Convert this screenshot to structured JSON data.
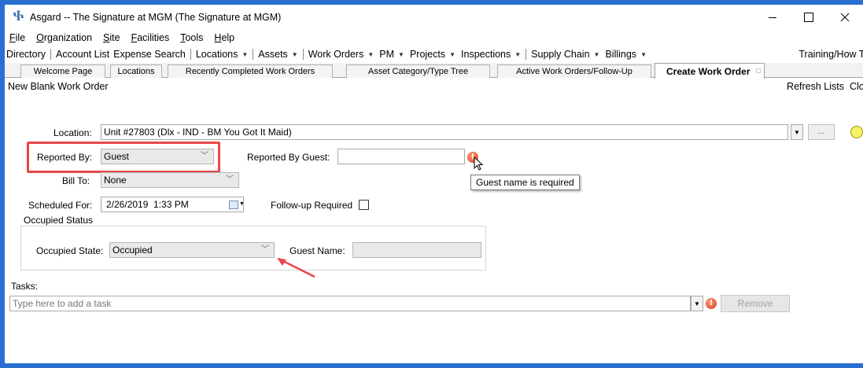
{
  "window": {
    "title": "Asgard -- The Signature at MGM (The Signature at MGM)",
    "app_icon": "asgard-logo-icon",
    "controls": [
      "minimize",
      "maximize",
      "close"
    ]
  },
  "menu": [
    {
      "label": "File",
      "accel": "F",
      "rest": "ile"
    },
    {
      "label": "Organization",
      "accel": "O",
      "rest": "rganization"
    },
    {
      "label": "Site",
      "accel": "S",
      "rest": "ite"
    },
    {
      "label": "Facilities",
      "accel": "F",
      "rest": "acilities"
    },
    {
      "label": "Tools",
      "accel": "T",
      "rest": "ools"
    },
    {
      "label": "Help",
      "accel": "H",
      "rest": "elp"
    }
  ],
  "toolbar": {
    "directory": "Directory",
    "account_list": "Account List",
    "expense_search": "Expense Search",
    "locations": "Locations",
    "assets": "Assets",
    "work_orders": "Work Orders",
    "pm": "PM",
    "projects": "Projects",
    "inspections": "Inspections",
    "supply_chain": "Supply Chain",
    "billings": "Billings",
    "training": "Training/How To"
  },
  "tabs": [
    {
      "label": "Welcome Page"
    },
    {
      "label": "Locations"
    },
    {
      "label": "Recently Completed Work Orders"
    },
    {
      "label": "Asset Category/Type Tree"
    },
    {
      "label": "Active Work Orders/Follow-Up"
    },
    {
      "label": "Create Work Order",
      "active": true
    }
  ],
  "header": {
    "title": "New Blank Work Order",
    "refresh": "Refresh Lists",
    "close": "Clos"
  },
  "form": {
    "location_label": "Location:",
    "location_value": "Unit #27803 (Dlx - IND - BM You Got It Maid)",
    "lookup_button": "...",
    "reported_by_label": "Reported By:",
    "reported_by_value": "Guest",
    "reported_by_guest_label": "Reported By Guest:",
    "reported_by_guest_value": "",
    "tooltip": "Guest name is required",
    "bill_to_label": "Bill To:",
    "bill_to_value": "None",
    "scheduled_for_label": "Scheduled For:",
    "scheduled_for_value": "2/26/2019  1:33 PM",
    "followup_label": "Follow-up Required",
    "followup_checked": false,
    "occupied_group_title": "Occupied Status",
    "occupied_state_label": "Occupied State:",
    "occupied_state_value": "Occupied",
    "guest_name_label": "Guest Name:",
    "guest_name_value": "",
    "tasks_label": "Tasks:",
    "task_placeholder": "Type here to add a task",
    "remove_button": "Remove"
  },
  "colors": {
    "window_border": "#2a6fd1",
    "annotation_red": "#e8474a",
    "error_icon": "#d63a15",
    "status_circle": "#f7f26a"
  }
}
